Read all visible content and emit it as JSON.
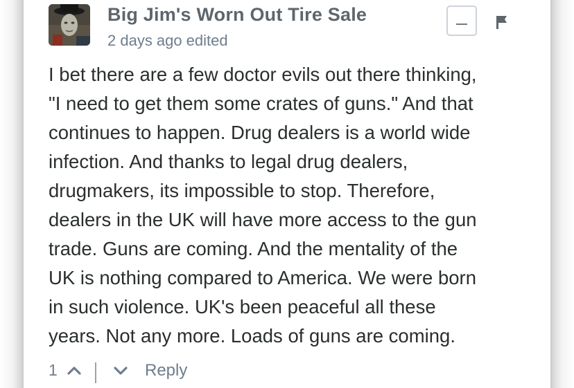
{
  "comment": {
    "author": "Big Jim's Worn Out Tire Sale",
    "time": "2 days ago",
    "edited": "edited",
    "body_lines": [
      "I bet there are a few doctor evils out there thinking,",
      "\"I need to get them some crates of guns.\" And that",
      "continues to happen. Drug dealers is a world wide",
      "infection. And thanks to legal drug dealers,",
      "drugmakers, its impossible to stop. Therefore,",
      "dealers in the UK will have more access to the gun",
      "trade. Guns are coming. And the mentality of the",
      "UK is nothing compared to America. We were born",
      "in such violence. UK's been peaceful all these",
      "years. Not any more. Loads of guns are coming."
    ],
    "upvote_count": "1",
    "reply_label": "Reply"
  },
  "icons": {
    "collapse": "minus-icon",
    "flag": "flag-icon",
    "upvote": "chevron-up-icon",
    "downvote": "chevron-down-icon"
  },
  "colors": {
    "author": "#5e666c",
    "meta": "#6e7d8e",
    "body": "#2a2e2e",
    "border": "#cdd3d9"
  }
}
